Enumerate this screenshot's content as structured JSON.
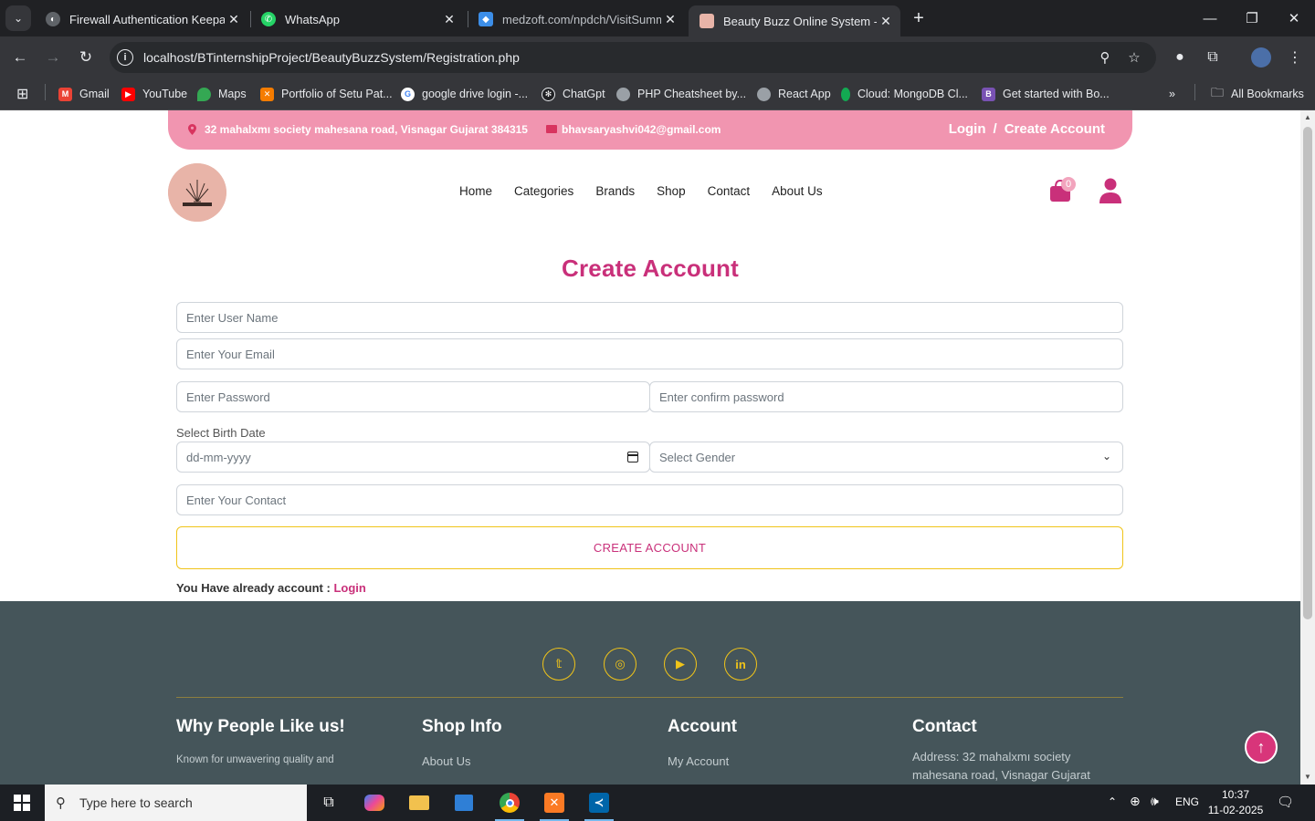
{
  "browser": {
    "tabs": [
      {
        "title": "Firewall Authentication Keepalive"
      },
      {
        "title": "WhatsApp"
      },
      {
        "title": "medzoft.com/npdch/VisitSummary"
      },
      {
        "title": "Beauty Buzz Online System - Registration"
      }
    ],
    "url": "localhost/BTinternshipProject/BeautyBuzzSystem/Registration.php",
    "bookmarks": [
      {
        "label": "Gmail"
      },
      {
        "label": "YouTube"
      },
      {
        "label": "Maps"
      },
      {
        "label": "Portfolio of Setu Pat..."
      },
      {
        "label": "google drive login -..."
      },
      {
        "label": "ChatGpt"
      },
      {
        "label": "PHP Cheatsheet by..."
      },
      {
        "label": "React App"
      },
      {
        "label": "Cloud: MongoDB Cl..."
      },
      {
        "label": "Get started with Bo..."
      }
    ],
    "all_bookmarks": "All Bookmarks"
  },
  "topbar": {
    "address": "32 mahalxmı society mahesana road, Visnagar Gujarat 384315",
    "email": "bhavsaryashvi042@gmail.com",
    "login": "Login",
    "separator": "/",
    "create_account": "Create Account"
  },
  "nav": {
    "items": [
      "Home",
      "Categories",
      "Brands",
      "Shop",
      "Contact",
      "About Us"
    ],
    "cart_count": "0"
  },
  "form": {
    "title": "Create Account",
    "username_placeholder": "Enter User Name",
    "email_placeholder": "Enter Your Email",
    "password_placeholder": "Enter Password",
    "confirm_placeholder": "Enter confirm password",
    "birth_label": "Select Birth Date",
    "date_placeholder": "dd-mm-yyyy",
    "gender_placeholder": "Select Gender",
    "contact_placeholder": "Enter Your Contact",
    "submit": "CREATE ACCOUNT",
    "already_text": "You Have already account :",
    "login_link": "Login"
  },
  "footer": {
    "col1_title": "Why People Like us!",
    "col1_text": "Known for unwavering quality and",
    "col2_title": "Shop Info",
    "col2_link": "About Us",
    "col3_title": "Account",
    "col3_link": "My Account",
    "col4_title": "Contact",
    "col4_line1": "Address: 32 mahalxmı society",
    "col4_line2": "mahesana road, Visnagar Gujarat"
  },
  "taskbar": {
    "search_placeholder": "Type here to search",
    "lang": "ENG",
    "time": "10:37",
    "date": "11-02-2025"
  },
  "colors": {
    "brand_pink": "#c9307a",
    "topbar_pink": "#f195b0",
    "footer_bg": "#45555a",
    "accent_yellow": "#f0c419"
  }
}
